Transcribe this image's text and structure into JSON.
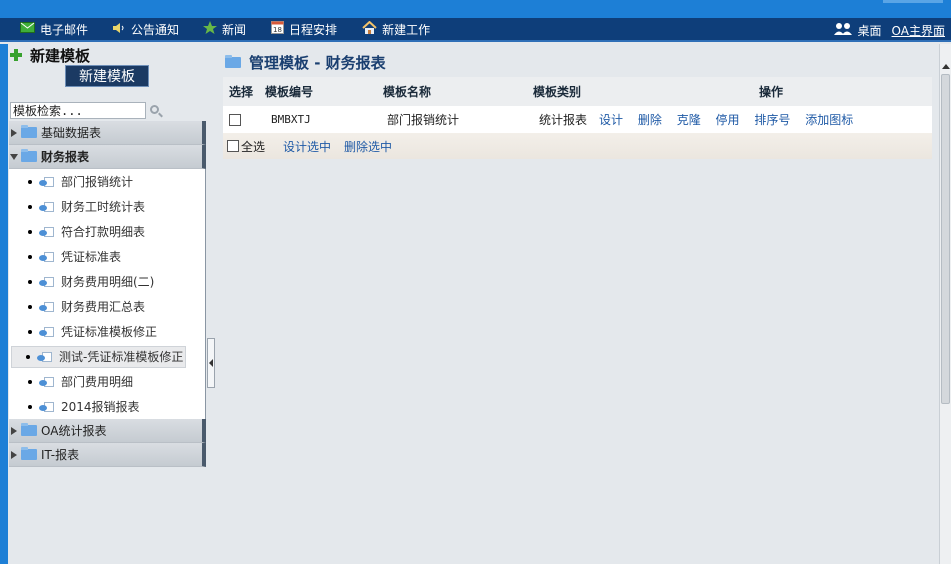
{
  "topnav": {
    "items": [
      {
        "label": "电子邮件",
        "icon": "mail-icon"
      },
      {
        "label": "公告通知",
        "icon": "speaker-icon"
      },
      {
        "label": "新闻",
        "icon": "star-icon"
      },
      {
        "label": "日程安排",
        "icon": "calendar-icon"
      },
      {
        "label": "新建工作",
        "icon": "home-icon"
      }
    ],
    "desktop_label": "桌面",
    "home_label": "OA主界面"
  },
  "left": {
    "title": "新建模板",
    "new_button": "新建模板",
    "search_value": "模板检索...",
    "categories": [
      {
        "label": "基础数据表",
        "expanded": false
      },
      {
        "label": "财务报表",
        "expanded": true
      },
      {
        "label": "OA统计报表",
        "expanded": false
      },
      {
        "label": "IT-报表",
        "expanded": false
      }
    ],
    "items": [
      "部门报销统计",
      "财务工时统计表",
      "符合打款明细表",
      "凭证标准表",
      "财务费用明细(二)",
      "财务费用汇总表",
      "凭证标准模板修正",
      "测试-凭证标准模板修正",
      "部门费用明细",
      "2014报销报表"
    ],
    "selected_item_index": 7
  },
  "main": {
    "title": "管理模板 - 财务报表",
    "headers": {
      "select": "选择",
      "code": "模板编号",
      "name": "模板名称",
      "type": "模板类别",
      "ops": "操作"
    },
    "rows": [
      {
        "code": "BMBXTJ",
        "name": "部门报销统计",
        "type": "统计报表",
        "ops": [
          "设计",
          "删除",
          "克隆",
          "停用",
          "排序号",
          "添加图标"
        ]
      }
    ],
    "footer": {
      "select_all": "全选",
      "design_selected": "设计选中",
      "delete_selected": "删除选中"
    }
  },
  "colors": {
    "nav_bg": "#0e3e7a",
    "accent": "#1d7fd6",
    "link": "#1f5aa6"
  }
}
